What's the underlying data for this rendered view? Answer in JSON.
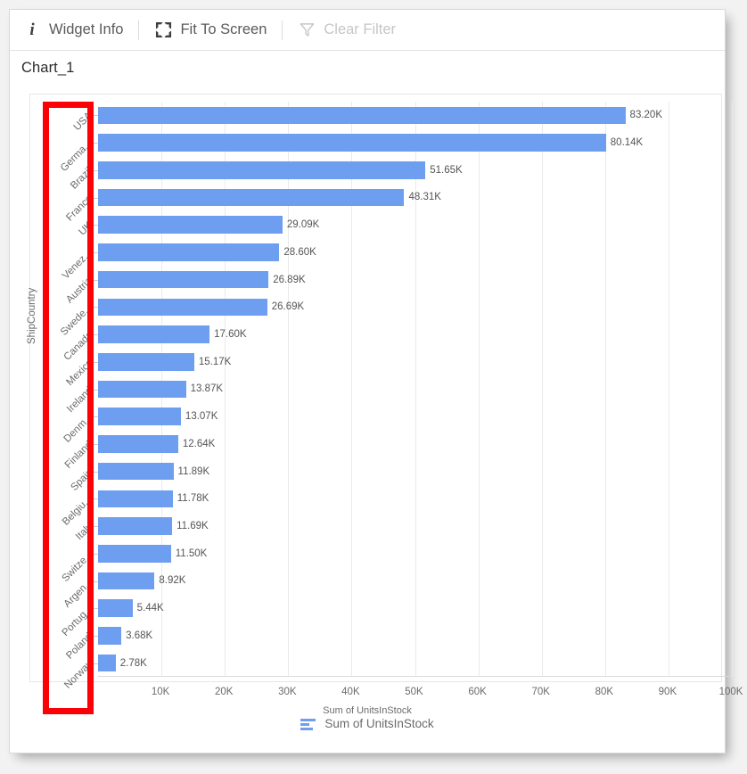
{
  "toolbar": {
    "items": [
      {
        "id": "widget-info",
        "label": "Widget Info",
        "icon": "info-icon",
        "disabled": false
      },
      {
        "id": "fit-to-screen",
        "label": "Fit To Screen",
        "icon": "expand-icon",
        "disabled": false
      },
      {
        "id": "clear-filter",
        "label": "Clear Filter",
        "icon": "filter-icon",
        "disabled": true
      }
    ]
  },
  "widget": {
    "title": "Chart_1"
  },
  "annotation": {
    "type": "highlight-rectangle",
    "color": "#fb0007",
    "target": "category-axis-labels"
  },
  "colors": {
    "bar": "#6d9eef",
    "gridline": "#eaeaea",
    "axis_text": "#6b6b6b",
    "annotation": "#fb0007"
  },
  "chart_data": {
    "type": "bar",
    "orientation": "horizontal",
    "title": "Chart_1",
    "xlabel": "Sum of UnitsInStock",
    "ylabel": "ShipCountry",
    "xlim": [
      0,
      100000
    ],
    "xticks": [
      10000,
      20000,
      30000,
      40000,
      50000,
      60000,
      70000,
      80000,
      90000,
      100000
    ],
    "xticklabels": [
      "10K",
      "20K",
      "30K",
      "40K",
      "50K",
      "60K",
      "70K",
      "80K",
      "90K",
      "100K"
    ],
    "grid": true,
    "legend": {
      "position": "bottom",
      "entries": [
        "Sum of UnitsInStock"
      ]
    },
    "series_name": "Sum of UnitsInStock",
    "categories": [
      "USA",
      "Germa...",
      "Brazil",
      "France",
      "UK",
      "Venez...",
      "Austria",
      "Swede...",
      "Canada",
      "Mexico",
      "Ireland",
      "Denm...",
      "Finland",
      "Spain",
      "Belgiu...",
      "Italy",
      "Switze...",
      "Argen...",
      "Portug...",
      "Poland",
      "Norway"
    ],
    "values": [
      83200,
      80140,
      51650,
      48310,
      29090,
      28600,
      26890,
      26690,
      17600,
      15170,
      13870,
      13070,
      12640,
      11890,
      11780,
      11690,
      11500,
      8920,
      5440,
      3680,
      2780
    ],
    "value_labels": [
      "83.20K",
      "80.14K",
      "51.65K",
      "48.31K",
      "29.09K",
      "28.60K",
      "26.89K",
      "26.69K",
      "17.60K",
      "15.17K",
      "13.87K",
      "13.07K",
      "12.64K",
      "11.89K",
      "11.78K",
      "11.69K",
      "11.50K",
      "8.92K",
      "5.44K",
      "3.68K",
      "2.78K"
    ]
  }
}
